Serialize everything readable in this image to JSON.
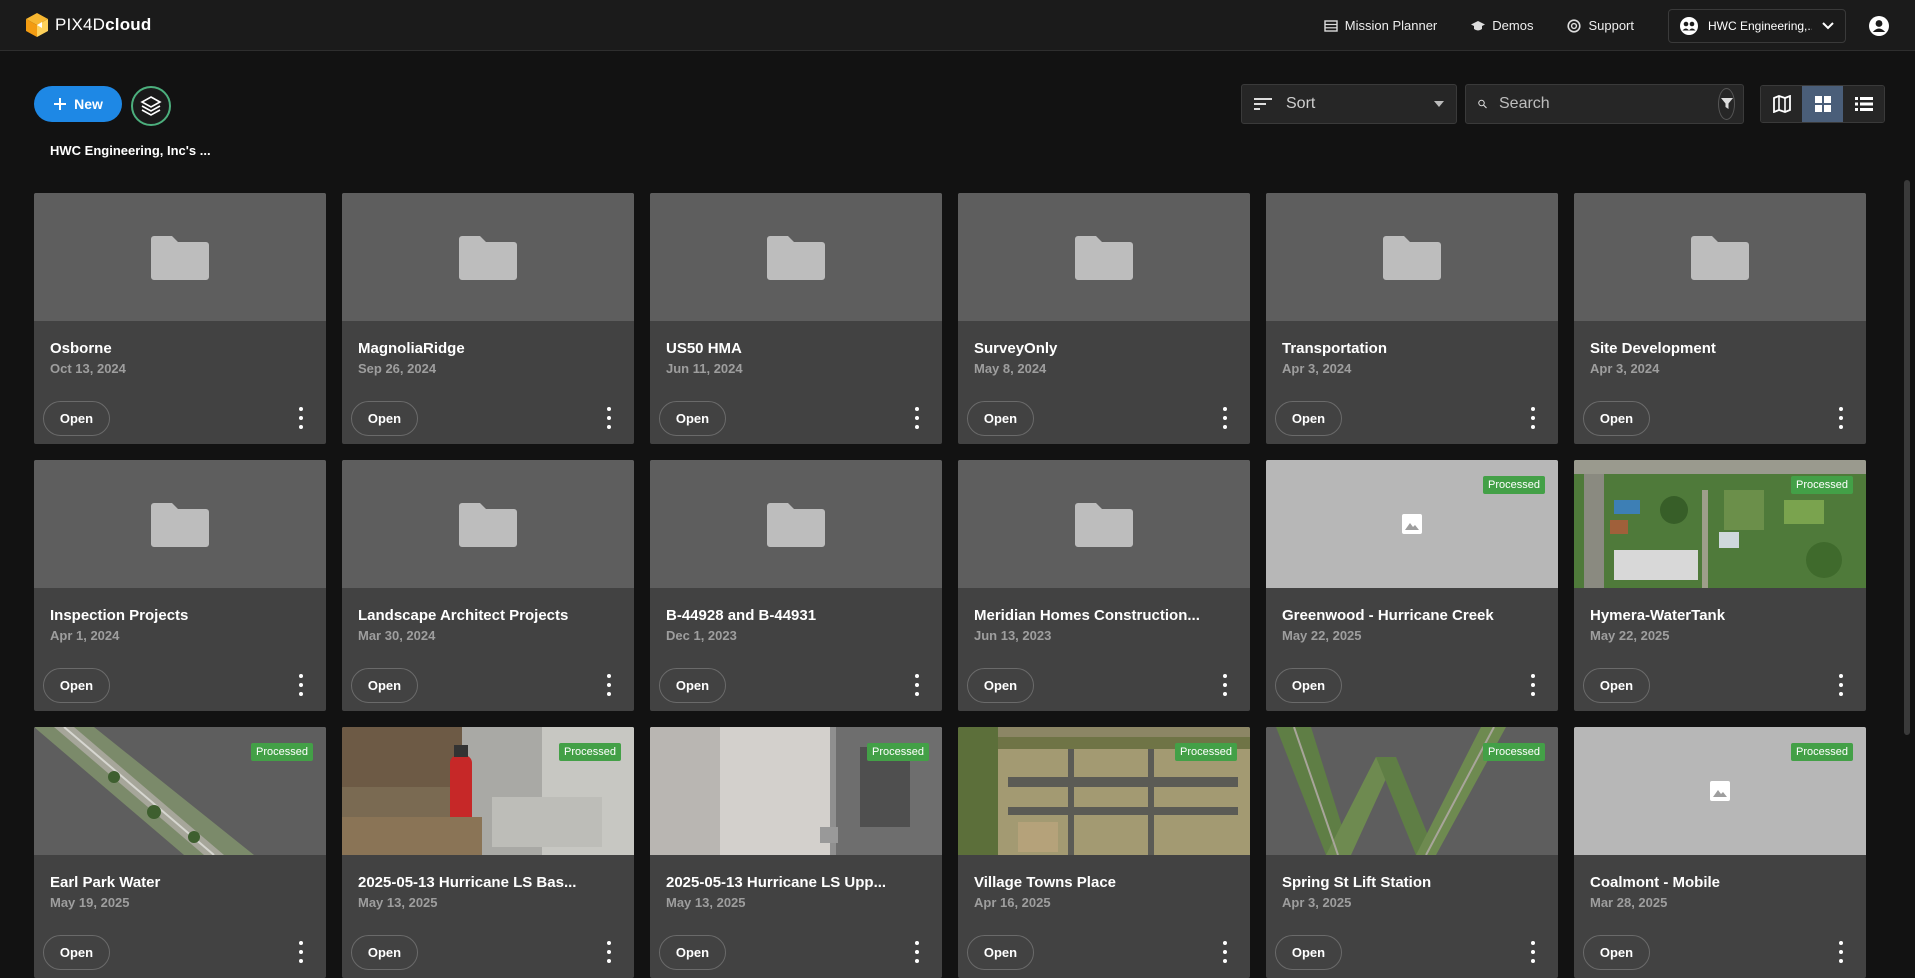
{
  "header": {
    "logo_prefix": "PIX4D",
    "logo_suffix": "cloud",
    "nav": [
      {
        "label": "Mission Planner",
        "icon": "list-icon"
      },
      {
        "label": "Demos",
        "icon": "graduation-cap-icon"
      },
      {
        "label": "Support",
        "icon": "lifebuoy-icon"
      }
    ],
    "org_selector": "HWC Engineering,...",
    "account_icon": "account-circle-icon"
  },
  "toolbar": {
    "new_label": "New",
    "breadcrumb": "HWC Engineering, Inc's ...",
    "sort_label": "Sort",
    "search_placeholder": "Search",
    "view_modes": [
      "map",
      "grid",
      "list"
    ],
    "active_view": "grid"
  },
  "colors": {
    "accent": "#1e88e5",
    "processed": "#43a047",
    "card": "#424242",
    "background": "#121212"
  },
  "cards": [
    {
      "title": "Osborne",
      "date": "Oct 13, 2024",
      "type": "folder",
      "badge": "",
      "open": "Open"
    },
    {
      "title": "MagnoliaRidge",
      "date": "Sep 26, 2024",
      "type": "folder",
      "badge": "",
      "open": "Open"
    },
    {
      "title": "US50 HMA",
      "date": "Jun 11, 2024",
      "type": "folder",
      "badge": "",
      "open": "Open"
    },
    {
      "title": "SurveyOnly",
      "date": "May 8, 2024",
      "type": "folder",
      "badge": "",
      "open": "Open"
    },
    {
      "title": "Transportation",
      "date": "Apr 3, 2024",
      "type": "folder",
      "badge": "",
      "open": "Open"
    },
    {
      "title": "Site Development",
      "date": "Apr 3, 2024",
      "type": "folder",
      "badge": "",
      "open": "Open"
    },
    {
      "title": "Inspection Projects",
      "date": "Apr 1, 2024",
      "type": "folder",
      "badge": "",
      "open": "Open"
    },
    {
      "title": "Landscape Architect Projects",
      "date": "Mar 30, 2024",
      "type": "folder",
      "badge": "",
      "open": "Open"
    },
    {
      "title": "B-44928 and B-44931",
      "date": "Dec 1, 2023",
      "type": "folder",
      "badge": "",
      "open": "Open"
    },
    {
      "title": "Meridian Homes Construction...",
      "date": "Jun 13, 2023",
      "type": "folder",
      "badge": "",
      "open": "Open"
    },
    {
      "title": "Greenwood - Hurricane Creek",
      "date": "May 22, 2025",
      "type": "placeholder",
      "badge": "Processed",
      "open": "Open"
    },
    {
      "title": "Hymera-WaterTank",
      "date": "May 22, 2025",
      "type": "aerial-green",
      "badge": "Processed",
      "open": "Open"
    },
    {
      "title": "Earl Park Water",
      "date": "May 19, 2025",
      "type": "aerial-strip",
      "badge": "Processed",
      "open": "Open"
    },
    {
      "title": "2025-05-13 Hurricane LS Bas...",
      "date": "May 13, 2025",
      "type": "photo-extinguisher",
      "badge": "Processed",
      "open": "Open"
    },
    {
      "title": "2025-05-13 Hurricane LS Upp...",
      "date": "May 13, 2025",
      "type": "photo-wall",
      "badge": "Processed",
      "open": "Open"
    },
    {
      "title": "Village Towns Place",
      "date": "Apr 16, 2025",
      "type": "aerial-site",
      "badge": "Processed",
      "open": "Open"
    },
    {
      "title": "Spring St Lift Station",
      "date": "Apr 3, 2025",
      "type": "aerial-w",
      "badge": "Processed",
      "open": "Open"
    },
    {
      "title": "Coalmont - Mobile",
      "date": "Mar 28, 2025",
      "type": "placeholder",
      "badge": "Processed",
      "open": "Open"
    }
  ]
}
